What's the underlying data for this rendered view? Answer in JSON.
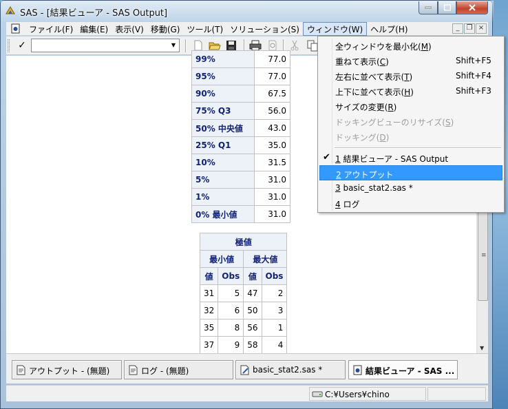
{
  "window": {
    "title": "SAS - [結果ビューア - SAS Output]"
  },
  "menubar": {
    "items": [
      {
        "label": "ファイル(F)"
      },
      {
        "label": "編集(E)"
      },
      {
        "label": "表示(V)"
      },
      {
        "label": "移動(G)"
      },
      {
        "label": "ツール(T)"
      },
      {
        "label": "ソリューション(S)"
      },
      {
        "label": "ウィンドウ(W)",
        "open": true
      },
      {
        "label": "ヘルプ(H)"
      }
    ]
  },
  "toolbar": {
    "check_label": "✓",
    "command_value": ""
  },
  "quantiles": [
    {
      "label": "99%",
      "value": "77.0"
    },
    {
      "label": "95%",
      "value": "77.0"
    },
    {
      "label": "90%",
      "value": "67.5"
    },
    {
      "label": "75% Q3",
      "value": "56.0"
    },
    {
      "label": "50% 中央値",
      "value": "43.0"
    },
    {
      "label": "25% Q1",
      "value": "35.0"
    },
    {
      "label": "10%",
      "value": "31.5"
    },
    {
      "label": "5%",
      "value": "31.0"
    },
    {
      "label": "1%",
      "value": "31.0"
    },
    {
      "label": "0% 最小値",
      "value": "31.0"
    }
  ],
  "extremes": {
    "title": "極値",
    "min_header": "最小値",
    "max_header": "最大値",
    "col_value": "値",
    "col_obs": "Obs",
    "rows": [
      {
        "min_val": "31",
        "min_obs": "5",
        "max_val": "47",
        "max_obs": "2"
      },
      {
        "min_val": "32",
        "min_obs": "6",
        "max_val": "50",
        "max_obs": "3"
      },
      {
        "min_val": "35",
        "min_obs": "8",
        "max_val": "56",
        "max_obs": "1"
      },
      {
        "min_val": "37",
        "min_obs": "9",
        "max_val": "58",
        "max_obs": "4"
      }
    ]
  },
  "window_menu": {
    "items": [
      {
        "pre": "全ウィンドウを最小化(",
        "key": "M",
        "post": ")",
        "shortcut": ""
      },
      {
        "pre": "重ねて表示(",
        "key": "C",
        "post": ")",
        "shortcut": "Shift+F5"
      },
      {
        "pre": "左右に並べて表示(",
        "key": "T",
        "post": ")",
        "shortcut": "Shift+F4"
      },
      {
        "pre": "上下に並べて表示(",
        "key": "H",
        "post": ")",
        "shortcut": "Shift+F3"
      },
      {
        "pre": "サイズの変更(",
        "key": "R",
        "post": ")",
        "shortcut": ""
      },
      {
        "pre": "ドッキングビューのリサイズ(",
        "key": "S",
        "post": ")",
        "shortcut": "",
        "disabled": true
      },
      {
        "pre": "ドッキング(",
        "key": "D",
        "post": ")",
        "shortcut": "",
        "disabled": true
      }
    ],
    "windows": [
      {
        "key": "1",
        "label": " 結果ビューア - SAS Output",
        "checked": true
      },
      {
        "key": "2",
        "label": " アウトプット",
        "highlighted": true
      },
      {
        "key": "3",
        "label": " basic_stat2.sas *"
      },
      {
        "key": "4",
        "label": " ログ"
      }
    ]
  },
  "window_tabs": [
    {
      "label": "アウトプット - (無題)"
    },
    {
      "label": "ログ - (無題)"
    },
    {
      "label": "basic_stat2.sas *"
    },
    {
      "label": "結果ビューア - SAS ...",
      "active": true
    }
  ],
  "status": {
    "path": "C:¥Users¥chino"
  }
}
